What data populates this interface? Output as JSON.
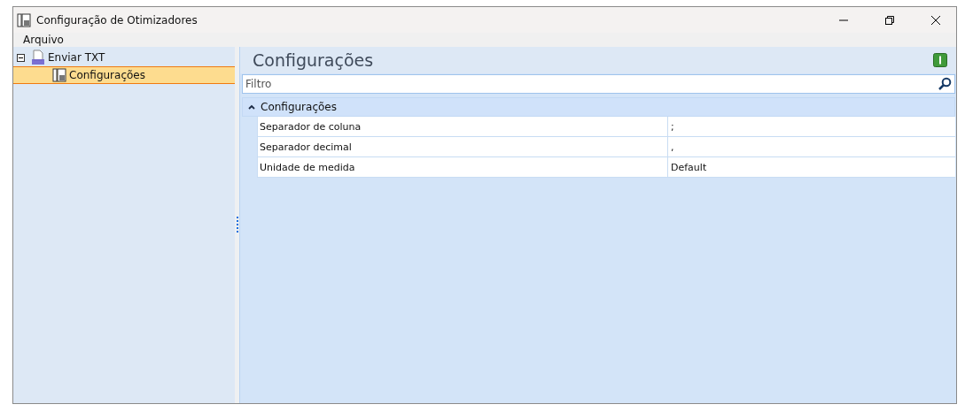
{
  "window": {
    "title": "Configuração de Otimizadores"
  },
  "menu": [
    "Arquivo"
  ],
  "tree": [
    {
      "label": "Enviar TXT",
      "expanded": true,
      "selected": false,
      "children": [
        {
          "label": "Configurações",
          "selected": true
        }
      ]
    }
  ],
  "panel": {
    "title": "Configurações",
    "filter": {
      "placeholder": "Filtro"
    },
    "group": {
      "label": "Configurações",
      "expanded": true,
      "rows": [
        {
          "name": "Separador de coluna",
          "value": ";"
        },
        {
          "name": "Separador decimal",
          "value": ","
        },
        {
          "name": "Unidade de medida",
          "value": "Default"
        }
      ]
    }
  }
}
